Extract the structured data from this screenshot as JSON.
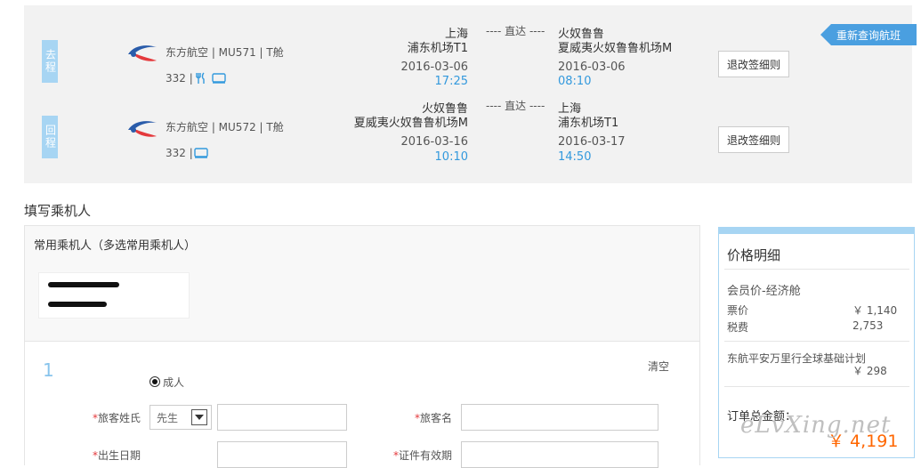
{
  "flights": [
    {
      "tag": "去程",
      "airline": "东方航空 | MU571 | T舱",
      "aircraft": "332 |",
      "icons": [
        "meal-icon",
        "entertainment-icon"
      ],
      "dep_city": "上海",
      "dep_airport": "浦东机场T1",
      "dep_date": "2016-03-06",
      "dep_time": "17:25",
      "direct": "---- 直达 ----",
      "arr_city": "火奴鲁鲁",
      "arr_airport": "夏威夷火奴鲁鲁机场M",
      "arr_date": "2016-03-06",
      "arr_time": "08:10",
      "rule_label": "退改签细则"
    },
    {
      "tag": "回程",
      "airline": "东方航空 | MU572 | T舱",
      "aircraft": "332 |",
      "icons": [
        "entertainment-icon"
      ],
      "dep_city": "火奴鲁鲁",
      "dep_airport": "夏威夷火奴鲁鲁机场M",
      "dep_date": "2016-03-16",
      "dep_time": "10:10",
      "direct": "---- 直达 ----",
      "arr_city": "上海",
      "arr_airport": "浦东机场T1",
      "arr_date": "2016-03-17",
      "arr_time": "14:50",
      "rule_label": "退改签细则"
    }
  ],
  "requery_label": "重新查询航班",
  "section_title": "填写乘机人",
  "frequent": {
    "title": "常用乘机人（多选常用乘机人）"
  },
  "form": {
    "index": "1",
    "clear_label": "清空",
    "passenger_type": "成人",
    "surname_label": "旅客姓氏",
    "title_value": "先生",
    "given_label": "旅客名",
    "birth_label": "出生日期",
    "expiry_label": "证件有效期",
    "required_mark": "*"
  },
  "price": {
    "title": "价格明细",
    "cabin": "会员价-经济舱",
    "fare_label": "票价",
    "fare_value": "￥ 1,140",
    "tax_label": "税费",
    "tax_value": "2,753",
    "insurance_label": "东航平安万里行全球基础计划",
    "insurance_value": "￥ 298",
    "total_label": "订单总金额：",
    "total_value": "￥ 4,191"
  },
  "watermark": "eLvXing.net",
  "colors": {
    "accent": "#3399dd",
    "tag": "#a7d5f3",
    "total": "#ff6600",
    "required": "#e4393c"
  }
}
